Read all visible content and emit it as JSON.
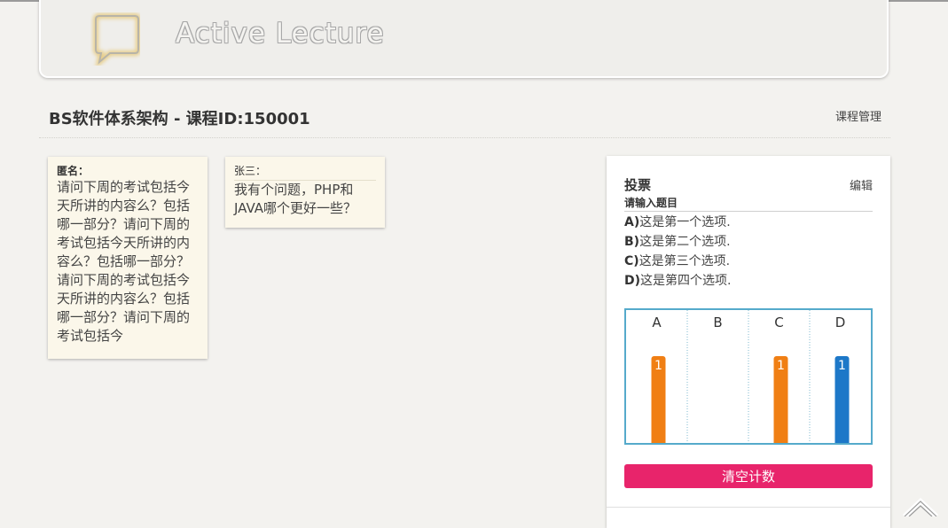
{
  "header": {
    "app_title": "Active Lecture",
    "logo_icon": "chat-bubble-icon"
  },
  "course": {
    "title": "BS软件体系架构 - 课程ID:150001",
    "manage_label": "课程管理"
  },
  "questions": [
    {
      "author": "匿名：",
      "text": "请问下周的考试包括今天所讲的内容么？包括哪一部分？请问下周的考试包括今天所讲的内容么？包括哪一部分？请问下周的考试包括今天所讲的内容么？包括哪一部分？请问下周的考试包括今"
    },
    {
      "author": "张三：",
      "text": "我有个问题，PHP和JAVA哪个更好一些？"
    }
  ],
  "vote": {
    "title": "投票",
    "edit_label": "编辑",
    "question": "请输入题目",
    "options": [
      {
        "letter": "A)",
        "text": "这是第一个选项."
      },
      {
        "letter": "B)",
        "text": "这是第二个选项."
      },
      {
        "letter": "C)",
        "text": "这是第三个选项."
      },
      {
        "letter": "D)",
        "text": "这是第四个选项."
      }
    ],
    "clear_label": "清空计数"
  },
  "chart_data": {
    "type": "bar",
    "categories": [
      "A",
      "B",
      "C",
      "D"
    ],
    "values": [
      1,
      0,
      1,
      1
    ],
    "data_labels": [
      "1",
      "",
      "1",
      "1"
    ],
    "colors": [
      "#f07f14",
      "#f07f14",
      "#f07f14",
      "#1d78c8"
    ],
    "ylim": [
      0,
      1
    ]
  },
  "colors": {
    "accent_pink": "#e8246b",
    "chart_border": "#55aacb",
    "bar_orange": "#f07f14",
    "bar_blue": "#1d78c8",
    "note_background": "#fbf7ea"
  },
  "icons": {
    "scroll_top": "chevron-up-icon"
  }
}
